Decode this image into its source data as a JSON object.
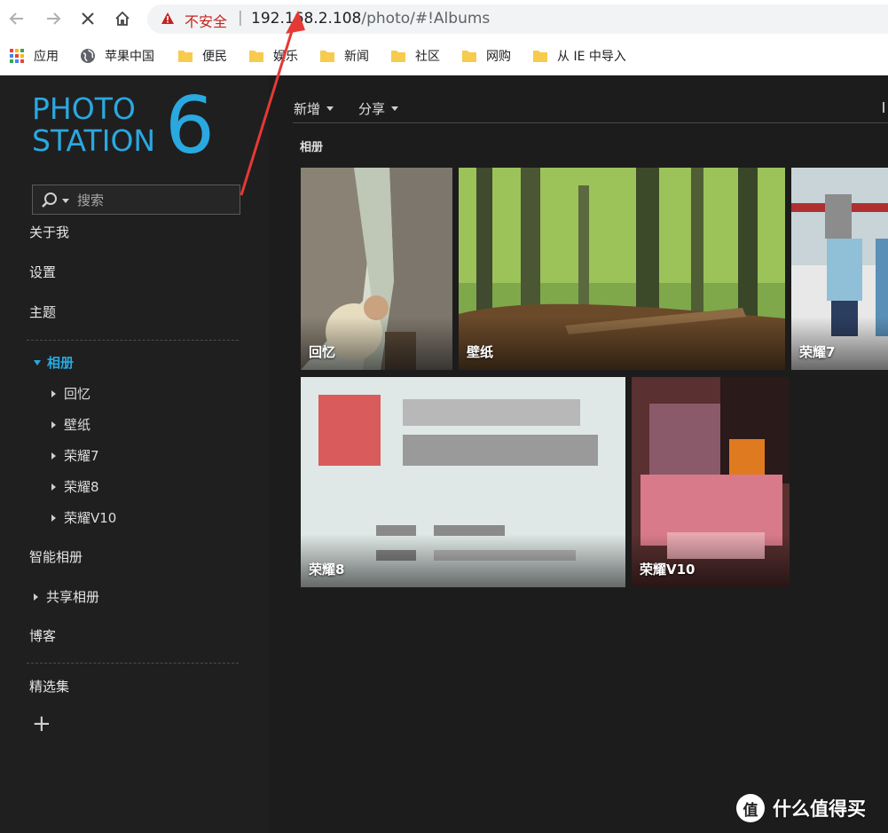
{
  "browser": {
    "security_label": "不安全",
    "url_host": "192.168.2.108",
    "url_path": "/photo/#!Albums",
    "bookmarks": [
      {
        "label": "应用",
        "icon": "apps-grid-icon"
      },
      {
        "label": "苹果中国",
        "icon": "globe-icon"
      },
      {
        "label": "便民",
        "icon": "folder-icon"
      },
      {
        "label": "娱乐",
        "icon": "folder-icon"
      },
      {
        "label": "新闻",
        "icon": "folder-icon"
      },
      {
        "label": "社区",
        "icon": "folder-icon"
      },
      {
        "label": "网购",
        "icon": "folder-icon"
      },
      {
        "label": "从 IE 中导入",
        "icon": "folder-icon"
      }
    ]
  },
  "app": {
    "logo_line1": "PHOTO",
    "logo_line2": "STATION",
    "logo_version": "6",
    "accent_color": "#2aa8e0",
    "search_placeholder": "搜索",
    "nav": {
      "about": "关于我",
      "settings": "设置",
      "theme": "主题",
      "albums": "相册",
      "album_children": [
        "回忆",
        "壁纸",
        "荣耀7",
        "荣耀8",
        "荣耀V10"
      ],
      "smart_albums": "智能相册",
      "shared_albums": "共享相册",
      "blog": "博客",
      "featured": "精选集",
      "add": "+"
    },
    "toolbar": {
      "new_label": "新增",
      "share_label": "分享"
    },
    "section_title": "相册",
    "tiles": [
      {
        "caption": "回忆"
      },
      {
        "caption": "壁纸"
      },
      {
        "caption": "荣耀7"
      },
      {
        "caption": "荣耀8"
      },
      {
        "caption": "荣耀V10"
      }
    ]
  },
  "watermark": {
    "icon": "值",
    "text": "什么值得买"
  }
}
